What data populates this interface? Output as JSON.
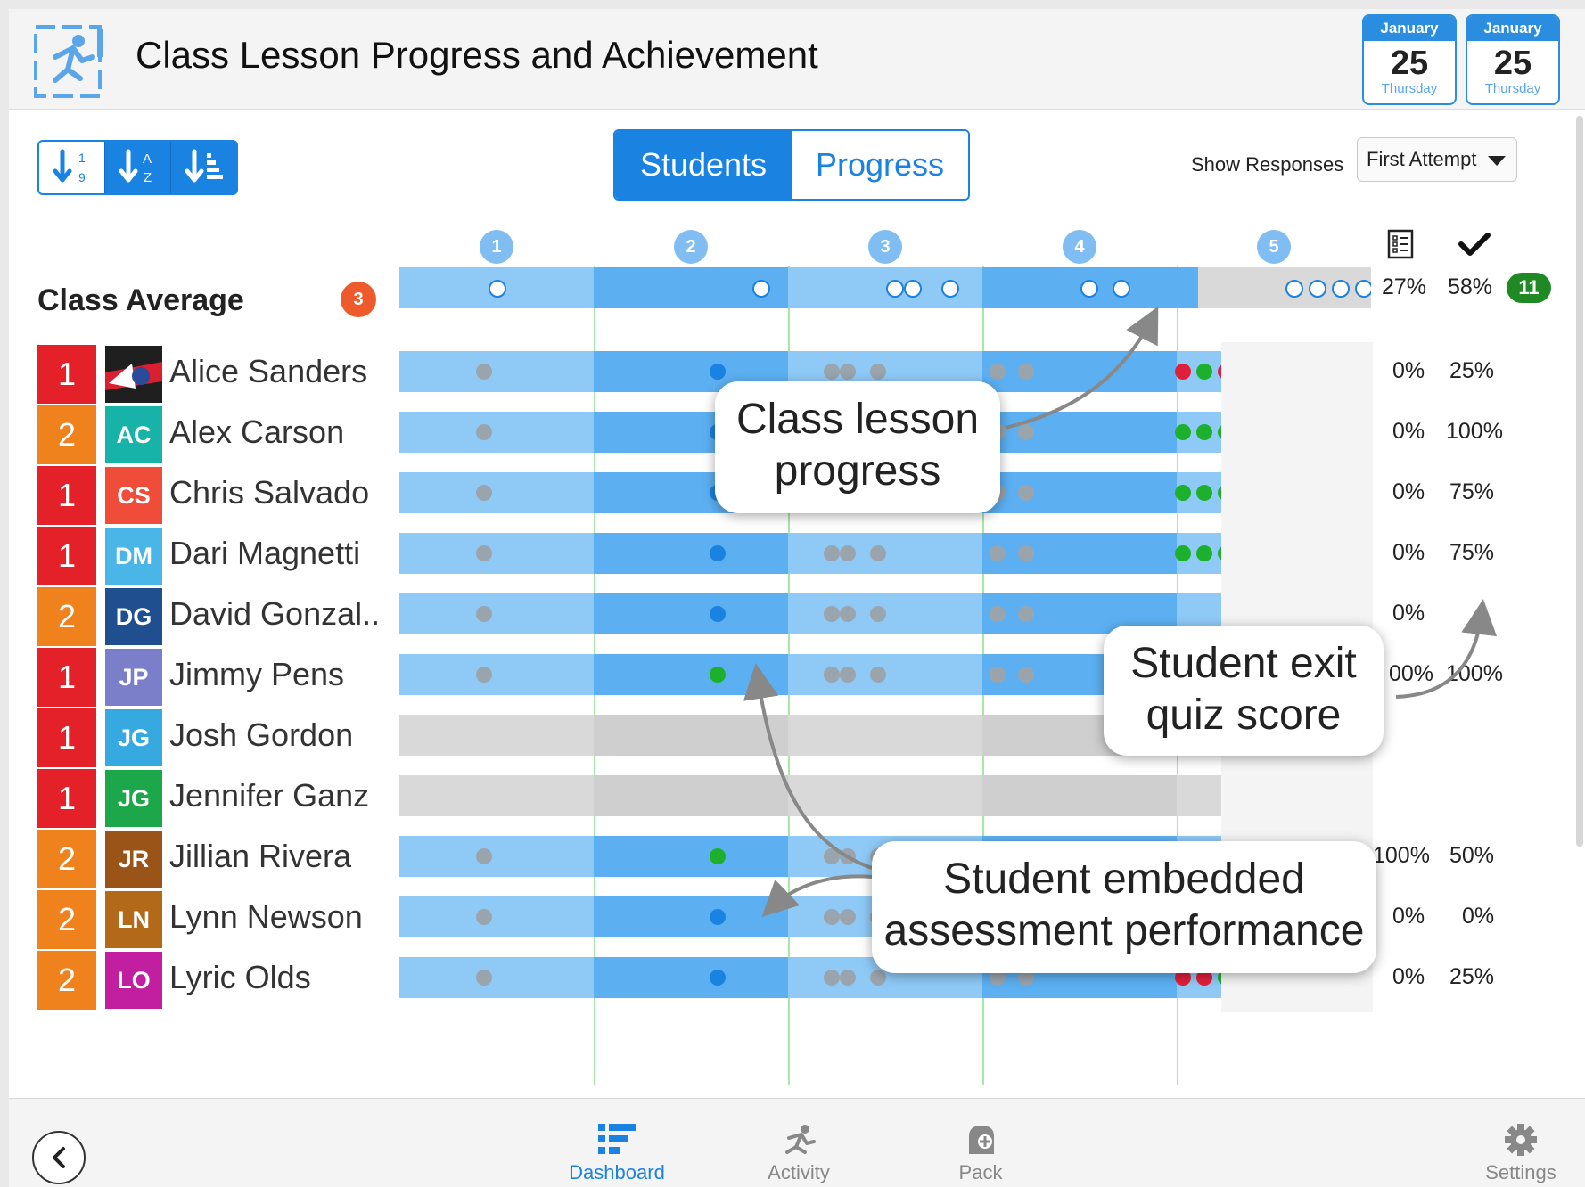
{
  "header": {
    "title": "Class Lesson Progress and Achievement",
    "calendars": [
      {
        "month": "January",
        "day": "25",
        "weekday": "Thursday"
      },
      {
        "month": "January",
        "day": "25",
        "weekday": "Thursday"
      }
    ]
  },
  "toolbar": {
    "sort_buttons": [
      "sort-numeric-icon",
      "sort-alpha-icon",
      "sort-bars-icon"
    ],
    "tabs": [
      "Students",
      "Progress"
    ],
    "active_tab": "Students",
    "show_responses_label": "Show Responses",
    "show_responses_value": "First Attempt"
  },
  "lesson_columns": [
    "1",
    "2",
    "3",
    "4",
    "5"
  ],
  "summary_icons": [
    "quiz-list-icon",
    "checkmark-icon"
  ],
  "class_average": {
    "label": "Class Average",
    "badge": "3",
    "embedded_pct": "27%",
    "quiz_pct": "58%",
    "completed_badge": "11"
  },
  "students": [
    {
      "level": "1",
      "initials": "",
      "name": "Alice Sanders",
      "embedded": "0%",
      "quiz": "25%",
      "status": "active"
    },
    {
      "level": "2",
      "initials": "AC",
      "name": "Alex Carson",
      "embedded": "0%",
      "quiz": "100%",
      "status": "active"
    },
    {
      "level": "1",
      "initials": "CS",
      "name": "Chris Salvado",
      "embedded": "0%",
      "quiz": "75%",
      "status": "active"
    },
    {
      "level": "1",
      "initials": "DM",
      "name": "Dari Magnetti",
      "embedded": "0%",
      "quiz": "75%",
      "status": "active"
    },
    {
      "level": "2",
      "initials": "DG",
      "name": "David Gonzal..",
      "embedded": "0%",
      "quiz": "",
      "status": "active"
    },
    {
      "level": "1",
      "initials": "JP",
      "name": "Jimmy Pens",
      "embedded": "00%",
      "quiz": "100%",
      "status": "active"
    },
    {
      "level": "1",
      "initials": "JG",
      "name": "Josh Gordon",
      "embedded": "",
      "quiz": "",
      "status": "inactive"
    },
    {
      "level": "1",
      "initials": "JG",
      "name": "Jennifer Ganz",
      "embedded": "",
      "quiz": "",
      "status": "inactive"
    },
    {
      "level": "2",
      "initials": "JR",
      "name": "Jillian Rivera",
      "embedded": "100%",
      "quiz": "50%",
      "status": "active"
    },
    {
      "level": "2",
      "initials": "LN",
      "name": "Lynn Newson",
      "embedded": "0%",
      "quiz": "0%",
      "status": "active"
    },
    {
      "level": "2",
      "initials": "LO",
      "name": "Lyric Olds",
      "embedded": "0%",
      "quiz": "25%",
      "status": "active"
    }
  ],
  "callouts": {
    "lesson_progress": [
      "Class lesson",
      "progress"
    ],
    "exit_quiz": [
      "Student exit",
      "quiz score"
    ],
    "embedded": [
      "Student embedded",
      "assessment performance"
    ]
  },
  "bottom_nav": {
    "items": [
      "Dashboard",
      "Activity",
      "Pack",
      "Settings"
    ],
    "active": "Dashboard"
  },
  "colors": {
    "accent": "#1a82e0",
    "level_1": "#e42128",
    "level_2": "#f0821e",
    "correct": "#1cb02c",
    "incorrect": "#e0203a"
  }
}
